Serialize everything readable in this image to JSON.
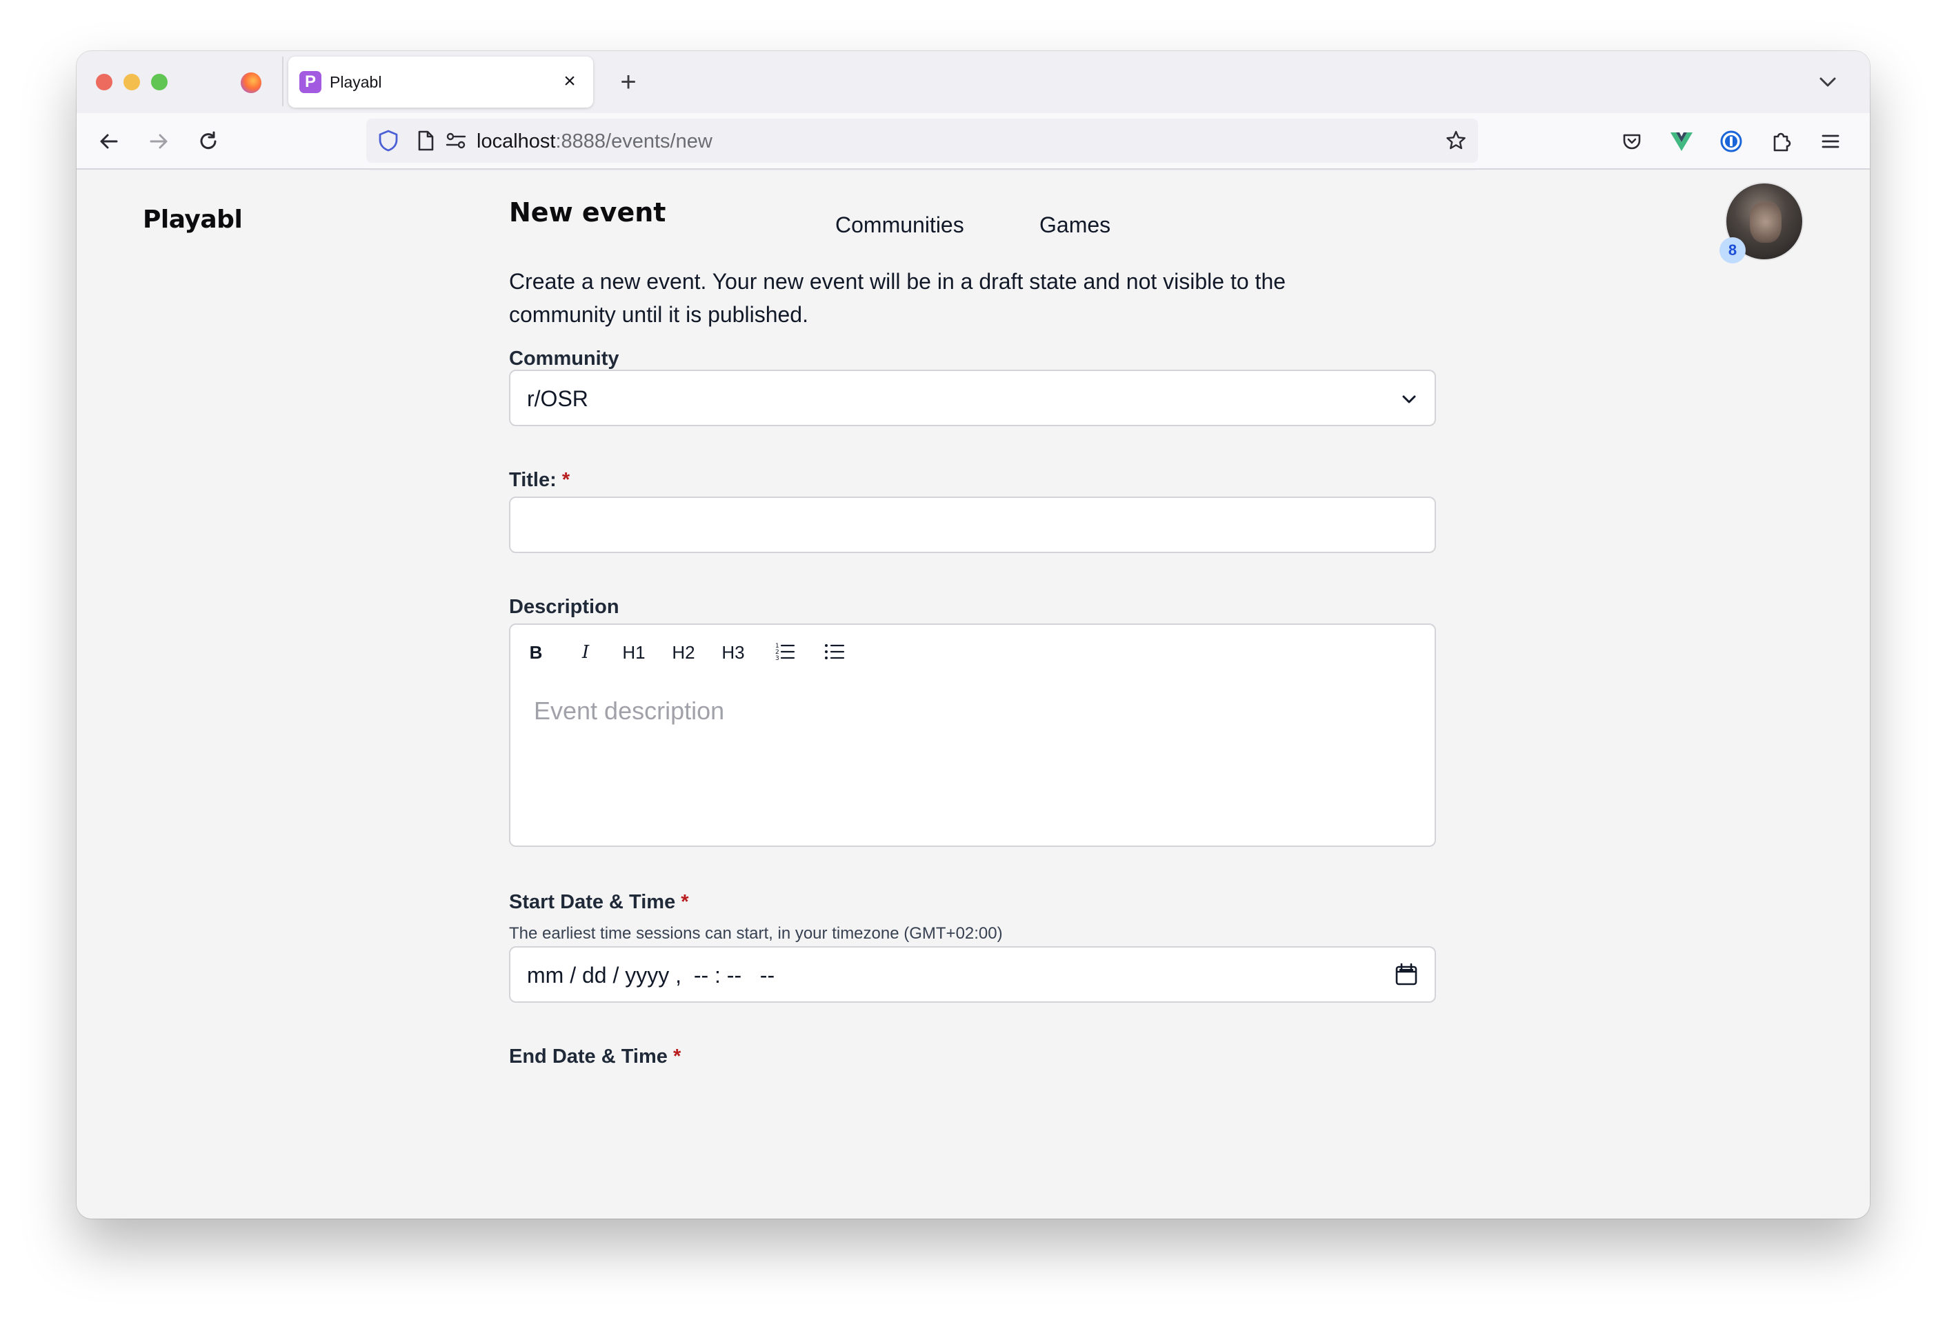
{
  "browser": {
    "tab_title": "Playabl",
    "tab_favicon_letter": "P",
    "tab_close": "×",
    "new_tab": "+",
    "url_host": "localhost",
    "url_path": ":8888/events/new"
  },
  "site": {
    "logo": "Playabl",
    "nav": [
      "Communities",
      "Games"
    ],
    "notification_count": "8"
  },
  "form": {
    "heading": "New event",
    "intro": "Create a new event. Your new event will be in a draft state and not visible to the community until it is published.",
    "community": {
      "label": "Community",
      "value": "r/OSR"
    },
    "title": {
      "label": "Title:",
      "required_mark": "*",
      "value": ""
    },
    "description": {
      "label": "Description",
      "toolbar": [
        "B",
        "I",
        "H1",
        "H2",
        "H3"
      ],
      "placeholder": "Event description"
    },
    "start": {
      "label": "Start Date & Time",
      "required_mark": "*",
      "hint": "The earliest time sessions can start, in your timezone (GMT+02:00)",
      "value": "mm / dd / yyyy ,  -- : --   --"
    },
    "end": {
      "label": "End Date & Time",
      "required_mark": "*"
    }
  },
  "icons": {
    "back": "arrow-left-icon",
    "forward": "arrow-right-icon",
    "reload": "reload-icon",
    "shield": "shield-icon",
    "page": "page-icon",
    "permissions": "permissions-icon",
    "bookmark": "star-icon",
    "pocket": "pocket-icon",
    "vue": "vue-devtools-icon",
    "onepassword": "1password-icon",
    "extensions": "puzzle-icon",
    "menu": "hamburger-menu-icon",
    "chevron": "chevron-down-icon",
    "calendar": "calendar-icon"
  },
  "colors": {
    "required": "#b91c1c",
    "badge_bg": "#bfdbfe",
    "badge_text": "#1d4ed8",
    "favicon": "#a25ae0"
  }
}
